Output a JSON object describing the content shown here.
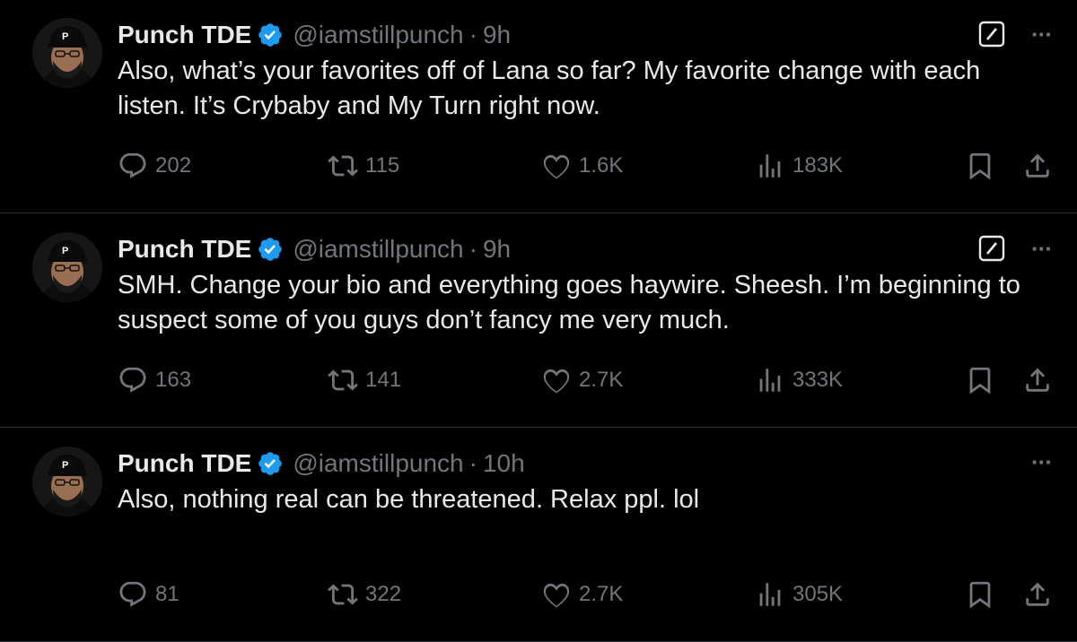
{
  "tweets": [
    {
      "author": "Punch TDE",
      "handle": "@iamstillpunch",
      "separator": "·",
      "time": "9h",
      "text": "Also, what’s your favorites off of Lana so far? My favorite change with each listen. It’s Crybaby and My Turn right now.",
      "show_grok": true,
      "replies": "202",
      "retweets": "115",
      "likes": "1.6K",
      "views": "183K"
    },
    {
      "author": "Punch TDE",
      "handle": "@iamstillpunch",
      "separator": "·",
      "time": "9h",
      "text": "SMH. Change your bio and everything goes haywire. Sheesh. I’m beginning to suspect some of you guys don’t fancy me very much.",
      "show_grok": true,
      "replies": "163",
      "retweets": "141",
      "likes": "2.7K",
      "views": "333K"
    },
    {
      "author": "Punch TDE",
      "handle": "@iamstillpunch",
      "separator": "·",
      "time": "10h",
      "text": "Also, nothing real can be threatened. Relax ppl. lol",
      "show_grok": false,
      "replies": "81",
      "retweets": "322",
      "likes": "2.7K",
      "views": "305K"
    }
  ],
  "more_label": "···",
  "colors": {
    "background": "#000000",
    "text": "#e7e9ea",
    "secondary": "#71767b",
    "verified": "#1d9bf0",
    "divider": "#2f3336"
  },
  "icons": [
    "verified-badge-icon",
    "grok-icon",
    "more-icon",
    "reply-icon",
    "retweet-icon",
    "like-icon",
    "views-icon",
    "bookmark-icon",
    "share-icon"
  ]
}
